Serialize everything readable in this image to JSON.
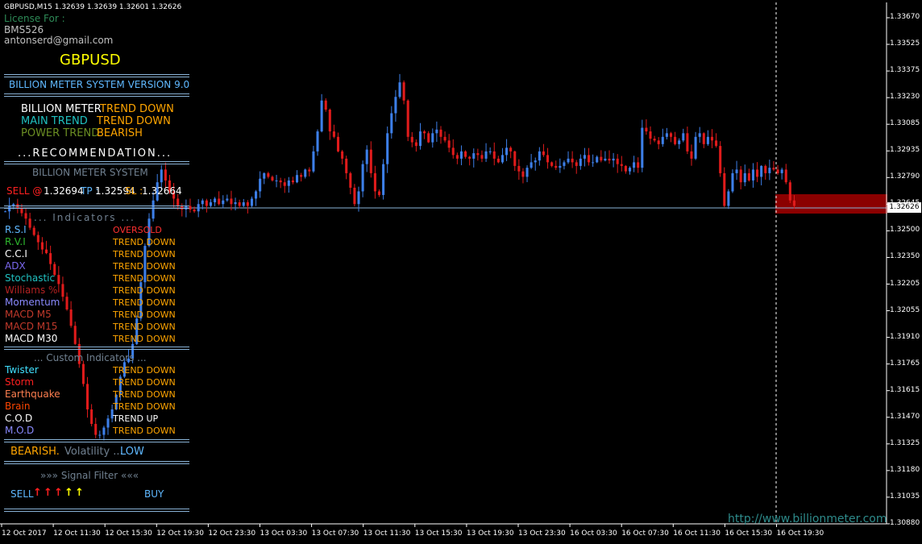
{
  "header": {
    "symbol_info": "GBPUSD,M15  1.32639 1.32639 1.32601 1.32626"
  },
  "license": {
    "line1": "License For :",
    "line2": "BMS526",
    "line3": "antonserd@gmail.com"
  },
  "panel": {
    "symbol": "GBPUSD",
    "version": "BILLION METER SYSTEM VERSION 9.0",
    "rows": [
      {
        "label": "BILLION METER",
        "value": "TREND DOWN"
      },
      {
        "label": "MAIN TREND",
        "value": "TREND DOWN"
      },
      {
        "label": "POWER TREND",
        "value": "BEARISH"
      }
    ],
    "recommendation": "...RECOMMENDATION...",
    "system_title": "BILLION METER SYSTEM",
    "signal": {
      "side": "SELL @",
      "entry": "1.32694",
      "tp_label": "TP :",
      "tp": "1.32594",
      "sl_label": "SL :",
      "sl": "1.32664"
    },
    "indicators_title": "... Indicators ...",
    "indicators": [
      {
        "name": "R.S.I",
        "value": "OVERSOLD",
        "name_color": "#5fb8ff",
        "value_color": "#ff3030"
      },
      {
        "name": "R.V.I",
        "value": "TREND DOWN",
        "name_color": "#2eb82e",
        "value_color": "#ffa500"
      },
      {
        "name": "C.C.I",
        "value": "TREND DOWN",
        "name_color": "#ffffff",
        "value_color": "#ffa500"
      },
      {
        "name": "ADX",
        "value": "TREND DOWN",
        "name_color": "#7b68ee",
        "value_color": "#ffa500"
      },
      {
        "name": "Stochastic",
        "value": "TREND DOWN",
        "name_color": "#20c0c0",
        "value_color": "#ffa500"
      },
      {
        "name": "Williams %",
        "value": "TREND DOWN",
        "name_color": "#b22222",
        "value_color": "#ffa500"
      },
      {
        "name": "Momentum",
        "value": "TREND DOWN",
        "name_color": "#8a8aff",
        "value_color": "#ffa500"
      },
      {
        "name": "MACD M5",
        "value": "TREND DOWN",
        "name_color": "#c0392b",
        "value_color": "#ffa500"
      },
      {
        "name": "MACD M15",
        "value": "TREND DOWN",
        "name_color": "#c0392b",
        "value_color": "#ffa500"
      },
      {
        "name": "MACD M30",
        "value": "TREND DOWN",
        "name_color": "#ffffff",
        "value_color": "#ffa500"
      }
    ],
    "custom_title": "... Custom Indicators ...",
    "custom": [
      {
        "name": "Twister",
        "value": "TREND DOWN",
        "name_color": "#40e0ff",
        "value_color": "#ffa500"
      },
      {
        "name": "Storm",
        "value": "TREND DOWN",
        "name_color": "#ff2020",
        "value_color": "#ffa500"
      },
      {
        "name": "Earthquake",
        "value": "TREND DOWN",
        "name_color": "#ff7f50",
        "value_color": "#ffa500"
      },
      {
        "name": "Brain",
        "value": "TREND DOWN",
        "name_color": "#ff4500",
        "value_color": "#ffa500"
      },
      {
        "name": "C.O.D",
        "value": "TREND UP",
        "name_color": "#ffffff",
        "value_color": "#ffffff"
      },
      {
        "name": "M.O.D",
        "value": "TREND DOWN",
        "name_color": "#8a8aff",
        "value_color": "#ffa500"
      }
    ],
    "bias": {
      "word": "BEARISH.",
      "volatility": "Volatility ...",
      "level": "LOW"
    },
    "signal_filter": "»»» Signal Filter «««",
    "sell_label": "SELL",
    "buy_label": "BUY",
    "arrows": [
      {
        "glyph": "↑",
        "color": "#ff2020"
      },
      {
        "glyph": "↑",
        "color": "#ff2020"
      },
      {
        "glyph": "↑",
        "color": "#ff2020"
      },
      {
        "glyph": "↑",
        "color": "#ffff00"
      },
      {
        "glyph": "↑",
        "color": "#ffff00"
      }
    ]
  },
  "watermark": "http://www.billionmeter.com",
  "current_price": "1.32626",
  "price_axis": [
    "1.33670",
    "1.33525",
    "1.33375",
    "1.33230",
    "1.33085",
    "1.32935",
    "1.32790",
    "1.32645",
    "1.32500",
    "1.32350",
    "1.32205",
    "1.32055",
    "1.31910",
    "1.31765",
    "1.31615",
    "1.31470",
    "1.31325",
    "1.31180",
    "1.31035",
    "1.30880"
  ],
  "time_axis": [
    "12 Oct 2017",
    "12 Oct 11:30",
    "12 Oct 15:30",
    "12 Oct 19:30",
    "12 Oct 23:30",
    "13 Oct 03:30",
    "13 Oct 07:30",
    "13 Oct 11:30",
    "13 Oct 15:30",
    "13 Oct 19:30",
    "13 Oct 23:30",
    "16 Oct 03:30",
    "16 Oct 07:30",
    "16 Oct 11:30",
    "16 Oct 15:30",
    "16 Oct 19:30"
  ],
  "colors": {
    "bull": "#3d7fe8",
    "bear": "#e01b1b",
    "axis": "#ffffff",
    "zone": "#8b0000",
    "price_line": "#8ab4d8"
  },
  "chart_data": {
    "type": "candlestick",
    "ylim": [
      1.3087,
      1.3374
    ],
    "close_series": [
      1.3259,
      1.3262,
      1.3263,
      1.3261,
      1.3258,
      1.3255,
      1.325,
      1.3246,
      1.3242,
      1.3238,
      1.3236,
      1.323,
      1.3224,
      1.3219,
      1.3212,
      1.3205,
      1.3196,
      1.3186,
      1.3175,
      1.3164,
      1.315,
      1.3142,
      1.3136,
      1.3136,
      1.314,
      1.3145,
      1.315,
      1.3158,
      1.3168,
      1.3176,
      1.3178,
      1.3186,
      1.32,
      1.322,
      1.324,
      1.3255,
      1.3265,
      1.3275,
      1.3282,
      1.3276,
      1.327,
      1.3266,
      1.3262,
      1.326,
      1.3262,
      1.326,
      1.3259,
      1.3263,
      1.3265,
      1.3262,
      1.3264,
      1.3266,
      1.3263,
      1.3265,
      1.3266,
      1.3263,
      1.3264,
      1.3262,
      1.3264,
      1.3262,
      1.3266,
      1.327,
      1.3277,
      1.328,
      1.3278,
      1.3276,
      1.3276,
      1.3275,
      1.3273,
      1.3276,
      1.3275,
      1.3279,
      1.3278,
      1.3282,
      1.3281,
      1.3292,
      1.3303,
      1.332,
      1.3315,
      1.3303,
      1.33,
      1.3292,
      1.3288,
      1.328,
      1.3272,
      1.3263,
      1.327,
      1.3285,
      1.3293,
      1.328,
      1.327,
      1.3268,
      1.3285,
      1.3302,
      1.3313,
      1.3322,
      1.333,
      1.332,
      1.33,
      1.3297,
      1.3295,
      1.3303,
      1.3302,
      1.3297,
      1.3302,
      1.3304,
      1.33,
      1.3298,
      1.3294,
      1.329,
      1.3288,
      1.3292,
      1.3289,
      1.3288,
      1.3291,
      1.329,
      1.3288,
      1.3292,
      1.3292,
      1.3288,
      1.3286,
      1.329,
      1.3294,
      1.3292,
      1.3284,
      1.3281,
      1.3278,
      1.3283,
      1.3286,
      1.3287,
      1.3292,
      1.329,
      1.3286,
      1.3284,
      1.3283,
      1.3284,
      1.3286,
      1.3288,
      1.3286,
      1.3284,
      1.3288,
      1.329,
      1.3286,
      1.3286,
      1.3289,
      1.3287,
      1.3288,
      1.3287,
      1.3288,
      1.3285,
      1.3284,
      1.3281,
      1.3283,
      1.3286,
      1.3283,
      1.3305,
      1.3303,
      1.3299,
      1.3298,
      1.3296,
      1.33,
      1.3302,
      1.33,
      1.3296,
      1.3298,
      1.3302,
      1.3292,
      1.3288,
      1.33,
      1.3302,
      1.3296,
      1.33,
      1.3298,
      1.3295,
      1.328,
      1.3262,
      1.327,
      1.328,
      1.3282,
      1.3275,
      1.328,
      1.3276,
      1.3282,
      1.3278,
      1.3284,
      1.328,
      1.3283,
      1.3282,
      1.328,
      1.3282,
      1.3275,
      1.3265,
      1.3262
    ]
  }
}
